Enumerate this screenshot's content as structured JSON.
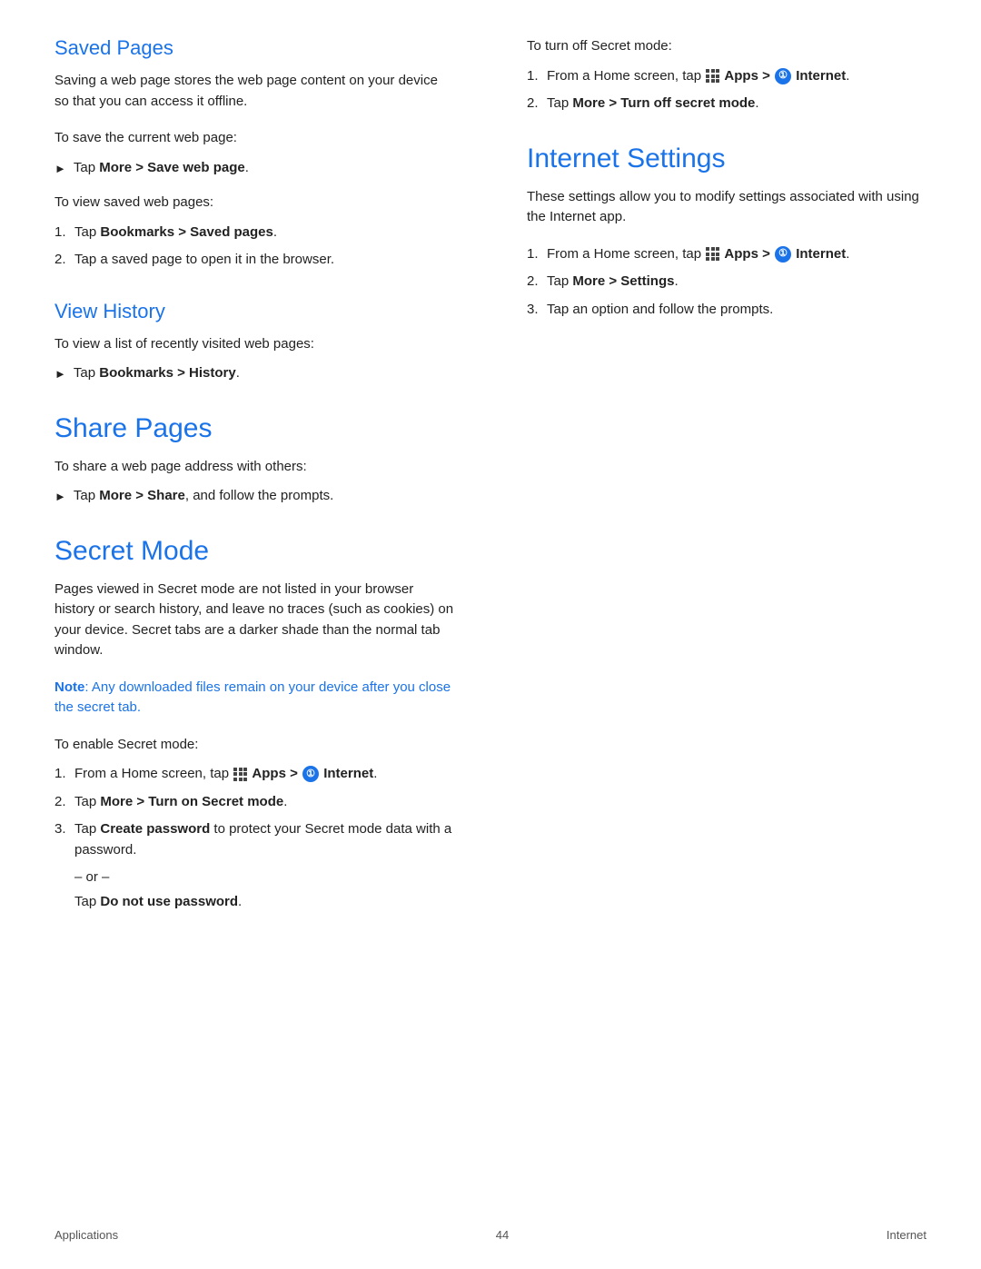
{
  "footer": {
    "left": "Applications",
    "center": "44",
    "right": "Internet"
  },
  "left_col": {
    "saved_pages": {
      "heading": "Saved Pages",
      "intro": "Saving a web page stores the web page content on your device so that you can access it offline.",
      "save_instruction": "To save the current web page:",
      "save_bullet": "Tap More > Save web page.",
      "view_instruction": "To view saved web pages:",
      "view_steps": [
        "Tap Bookmarks > Saved pages.",
        "Tap a saved page to open it in the browser."
      ]
    },
    "view_history": {
      "heading": "View History",
      "intro": "To view a list of recently visited web pages:",
      "bullet": "Tap Bookmarks > History."
    },
    "share_pages": {
      "heading": "Share Pages",
      "intro": "To share a web page address with others:",
      "bullet": "Tap More > Share, and follow the prompts."
    },
    "secret_mode": {
      "heading": "Secret Mode",
      "intro": "Pages viewed in Secret mode are not listed in your browser history or search history, and leave no traces (such as cookies) on your device. Secret tabs are a darker shade than the normal tab window.",
      "note": "Note: Any downloaded files remain on your device after you close the secret tab.",
      "enable_intro": "To enable Secret mode:",
      "enable_steps": [
        {
          "text": "From a Home screen, tap",
          "bold_after": "Apps >",
          "icon": "internet",
          "icon_label": "Internet",
          "icon_dot": true
        },
        {
          "text": "Tap More > Turn on Secret mode.",
          "plain": true
        },
        {
          "text": "Tap Create password to protect your Secret mode data with a password.",
          "plain": true
        }
      ],
      "or_text": "– or –",
      "tap_no_password": "Tap Do not use password."
    }
  },
  "right_col": {
    "turn_off_intro": "To turn off Secret mode:",
    "turn_off_steps": [
      {
        "text": "From a Home screen, tap",
        "bold_after": "Apps >",
        "icon": "internet",
        "icon_label": "Internet",
        "icon_dot": true
      },
      {
        "text": "Tap More > Turn off secret mode.",
        "plain": true
      }
    ],
    "internet_settings": {
      "heading": "Internet Settings",
      "intro": "These settings allow you to modify settings associated with using the Internet app.",
      "steps": [
        {
          "text": "From a Home screen, tap",
          "bold_after": "Apps >",
          "icon": "internet",
          "icon_label": "Internet",
          "icon_dot": true
        },
        {
          "text": "Tap More > Settings.",
          "plain": true
        },
        {
          "text": "Tap an option and follow the prompts.",
          "plain": true
        }
      ]
    }
  }
}
